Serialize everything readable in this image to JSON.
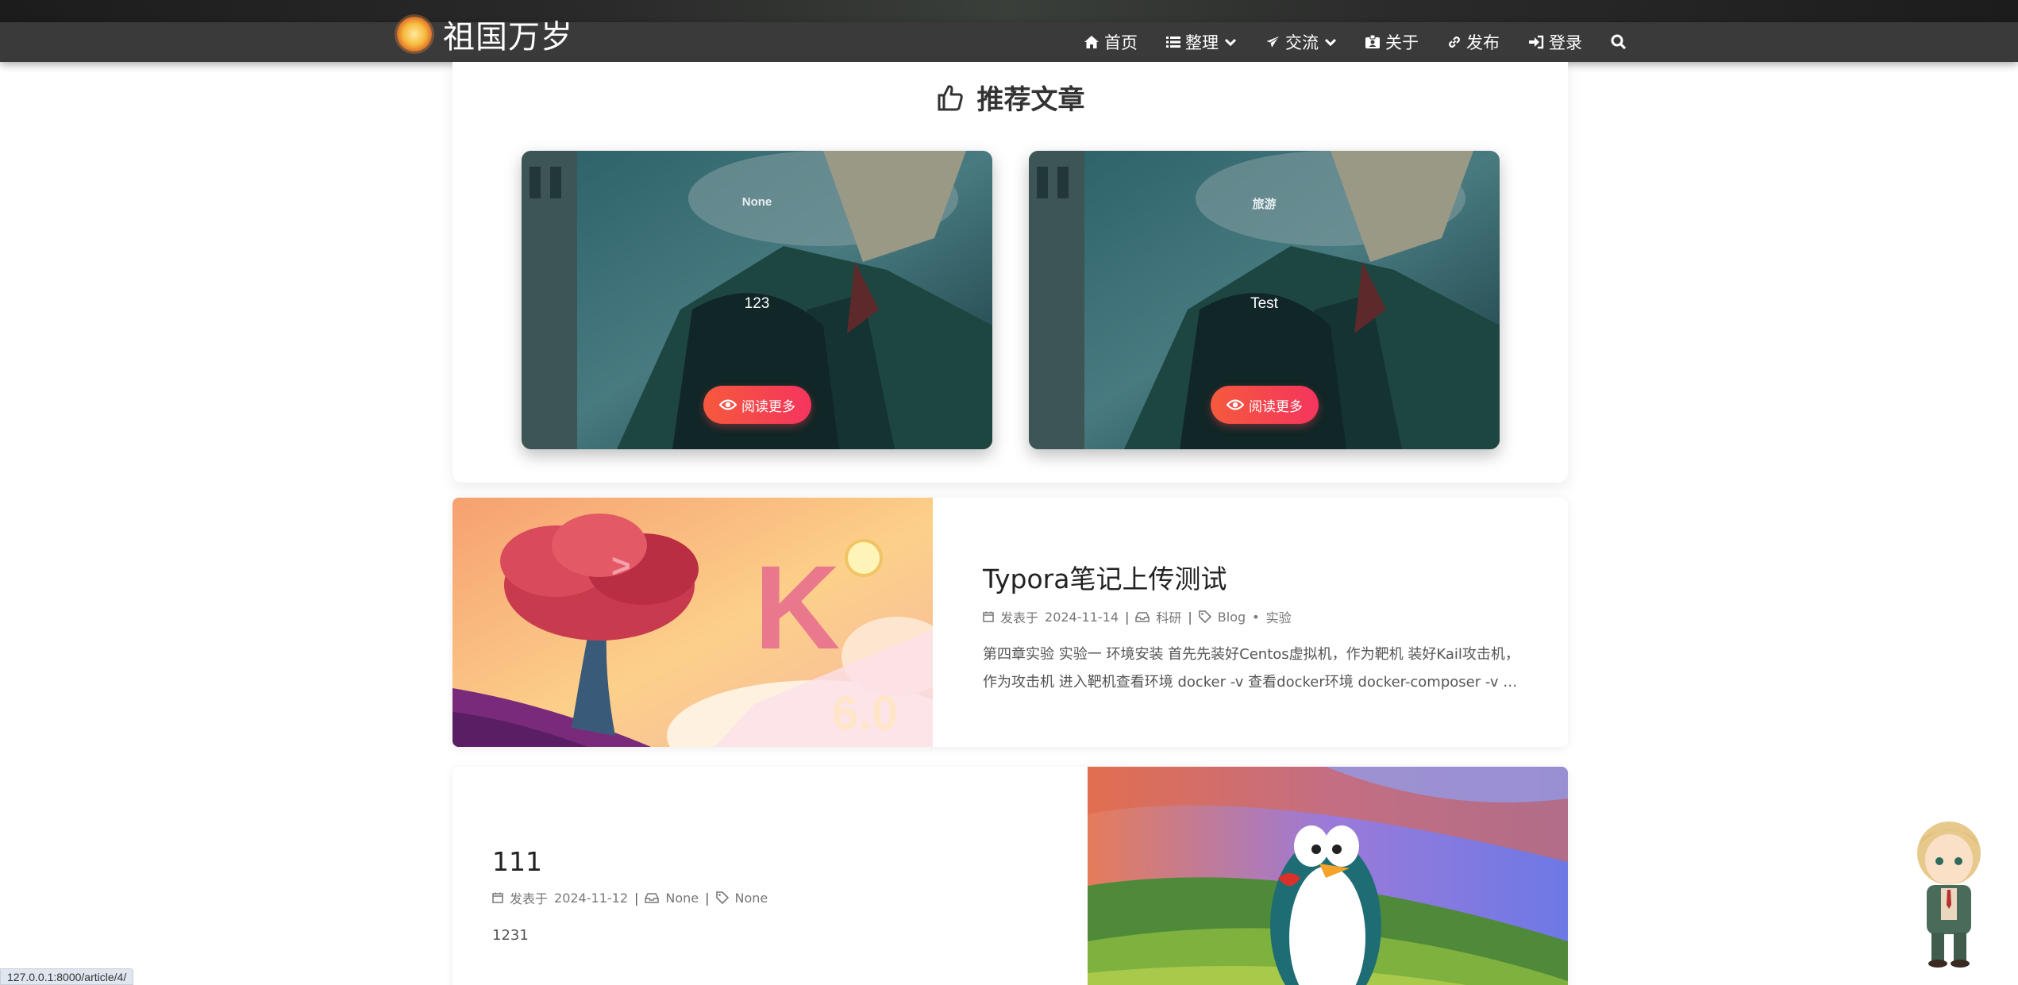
{
  "site": {
    "title": "祖国万岁"
  },
  "nav": [
    {
      "label": "首页",
      "icon": "home-icon"
    },
    {
      "label": "整理",
      "icon": "list-icon",
      "dropdown": true
    },
    {
      "label": "交流",
      "icon": "paper-plane-icon",
      "dropdown": true
    },
    {
      "label": "关于",
      "icon": "id-card-icon"
    },
    {
      "label": "发布",
      "icon": "link-icon"
    },
    {
      "label": "登录",
      "icon": "sign-in-icon"
    }
  ],
  "recommended": {
    "title": "推荐文章",
    "cards": [
      {
        "category": "None",
        "title": "123",
        "button": "阅读更多"
      },
      {
        "category": "旅游",
        "title": "Test",
        "button": "阅读更多"
      }
    ]
  },
  "articles": [
    {
      "title": "Typora笔记上传测试",
      "date_prefix": "发表于",
      "date": "2024-11-14",
      "category": "科研",
      "tags": [
        "Blog",
        "实验"
      ],
      "excerpt": "第四章实验 实验一 环境安装 首先先装好Centos虚拟机，作为靶机 装好Kail攻击机，作为攻击机 进入靶机查看环境 docker -v 查看docker环境 docker-composer -v 查看docker-..."
    },
    {
      "title": "111",
      "date_prefix": "发表于",
      "date": "2024-11-12",
      "category": "None",
      "tags": [
        "None"
      ],
      "excerpt": "1231"
    }
  ],
  "status_bar": {
    "url": "127.0.0.1:8000/article/4/"
  },
  "colors": {
    "navbar": "#3a3a3a",
    "button_start": "#f5593d",
    "button_end": "#f5355e"
  }
}
